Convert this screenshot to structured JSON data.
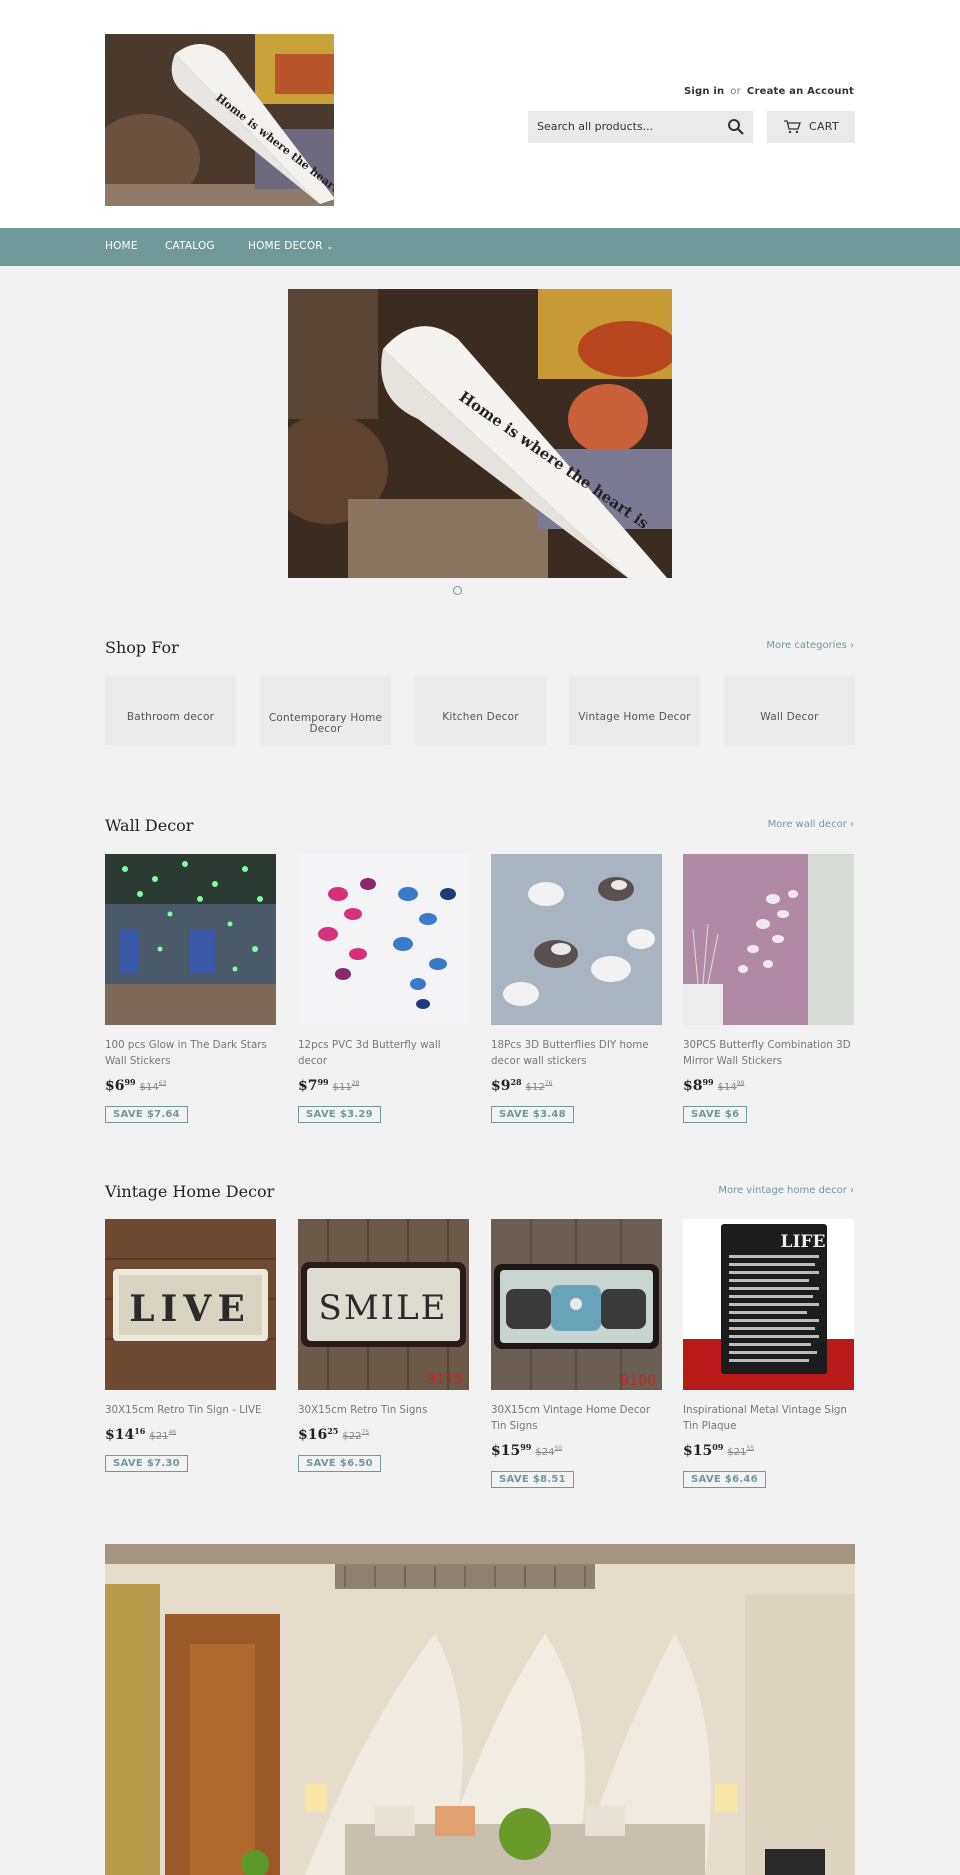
{
  "header": {
    "sign_in": "Sign in",
    "or": "or",
    "create_account": "Create an Account",
    "search_placeholder": "Search all products...",
    "cart_label": "CART",
    "logo_text": "Home is where the heart is"
  },
  "nav": {
    "items": [
      "HOME",
      "CATALOG",
      "HOME DECOR"
    ]
  },
  "shop_for": {
    "title": "Shop For",
    "more": "More categories ›",
    "categories": [
      "Bathroom decor",
      "Contemporary Home Decor",
      "Kitchen Decor",
      "Vintage Home Decor",
      "Wall Decor"
    ]
  },
  "wall_decor": {
    "title": "Wall Decor",
    "more": "More wall decor ›",
    "products": [
      {
        "title": "100 pcs Glow in The Dark Stars Wall Stickers",
        "price_main": "$6",
        "price_cents": "99",
        "old_main": "$14",
        "old_cents": "63",
        "save": "SAVE $7.64"
      },
      {
        "title": "12pcs PVC 3d Butterfly wall decor",
        "price_main": "$7",
        "price_cents": "99",
        "old_main": "$11",
        "old_cents": "28",
        "save": "SAVE $3.29"
      },
      {
        "title": "18Pcs 3D Butterflies DIY home decor wall stickers",
        "price_main": "$9",
        "price_cents": "28",
        "old_main": "$12",
        "old_cents": "76",
        "save": "SAVE $3.48"
      },
      {
        "title": "30PCS Butterfly Combination 3D Mirror Wall Stickers",
        "price_main": "$8",
        "price_cents": "99",
        "old_main": "$14",
        "old_cents": "99",
        "save": "SAVE $6"
      }
    ]
  },
  "vintage": {
    "title": "Vintage Home Decor",
    "more": "More vintage home decor ›",
    "products": [
      {
        "title": "30X15cm Retro Tin Sign - LIVE",
        "price_main": "$14",
        "price_cents": "16",
        "old_main": "$21",
        "old_cents": "46",
        "save": "SAVE $7.30",
        "sign_text": "LIVE"
      },
      {
        "title": "30X15cm Retro Tin Signs",
        "price_main": "$16",
        "price_cents": "25",
        "old_main": "$22",
        "old_cents": "75",
        "save": "SAVE $6.50",
        "sign_text": "SMILE",
        "sign_code": "9115"
      },
      {
        "title": "30X15cm Vintage Home Decor Tin Signs",
        "price_main": "$15",
        "price_cents": "99",
        "old_main": "$24",
        "old_cents": "50",
        "save": "SAVE $8.51",
        "sign_code": "9100"
      },
      {
        "title": "Inspirational Metal Vintage Sign Tin Plaque",
        "price_main": "$15",
        "price_cents": "09",
        "old_main": "$21",
        "old_cents": "55",
        "save": "SAVE $6.46",
        "sign_text": "LIFE"
      }
    ]
  },
  "colors": {
    "accent": "#70999a",
    "background": "#f2f2f2",
    "text": "#333333"
  }
}
